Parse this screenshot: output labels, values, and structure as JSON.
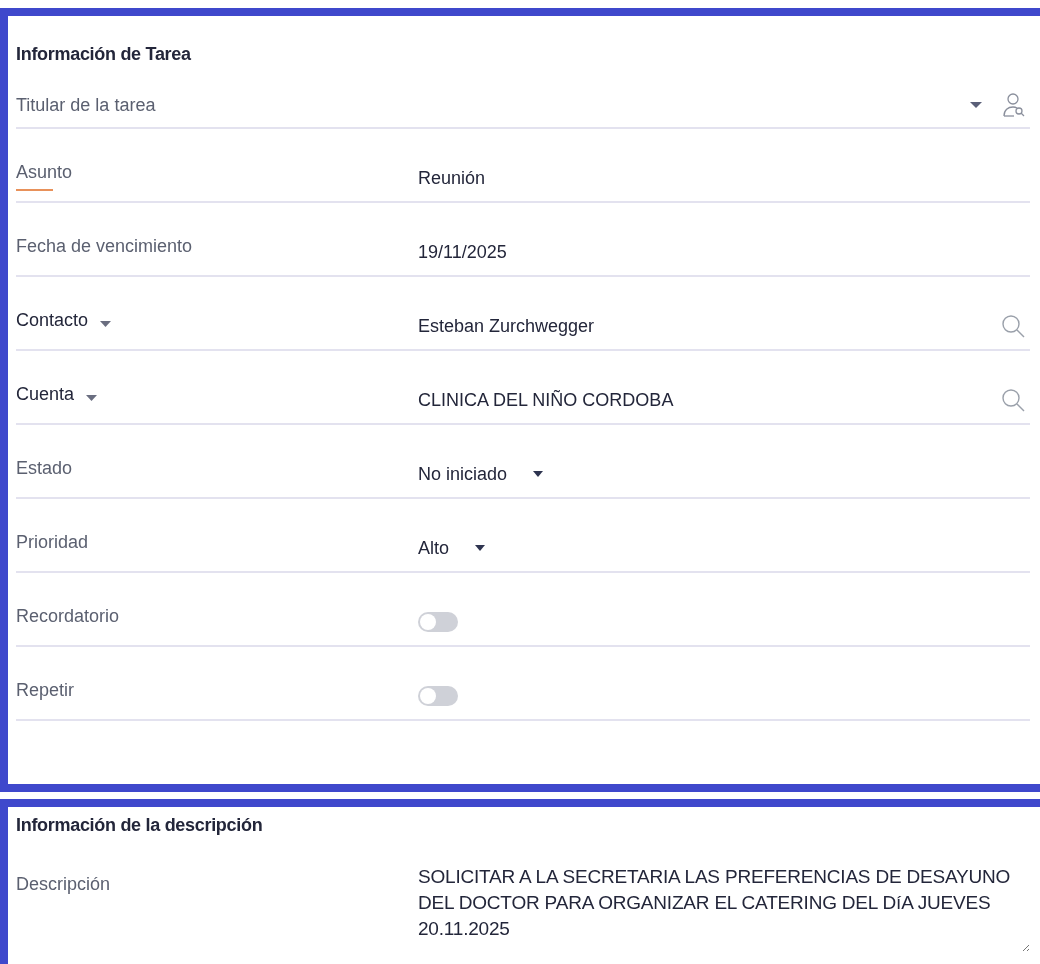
{
  "task_section": {
    "title": "Información de Tarea",
    "fields": [
      {
        "kind": "owner",
        "label": "Titular de la tarea"
      },
      {
        "kind": "text",
        "label": "Asunto",
        "value": "Reunión",
        "required": true
      },
      {
        "kind": "text",
        "label": "Fecha de vencimiento",
        "value": "19/11/2025"
      },
      {
        "kind": "lookup",
        "label": "Contacto",
        "value": "Esteban Zurchwegger"
      },
      {
        "kind": "lookup",
        "label": "Cuenta",
        "value": "CLINICA DEL NIÑO CORDOBA"
      },
      {
        "kind": "picklist",
        "label": "Estado",
        "value": "No iniciado"
      },
      {
        "kind": "picklist",
        "label": "Prioridad",
        "value": "Alto"
      },
      {
        "kind": "toggle",
        "label": "Recordatorio",
        "on": false
      },
      {
        "kind": "toggle",
        "label": "Repetir",
        "on": false
      }
    ]
  },
  "description_section": {
    "title": "Información de la descripción",
    "label": "Descripción",
    "value": "SOLICITAR A LA SECRETARIA LAS PREFERENCIAS DE DESAYUNO DEL DOCTOR PARA ORGANIZAR EL CATERING DEL DíA JUEVES 20.11.2025"
  }
}
